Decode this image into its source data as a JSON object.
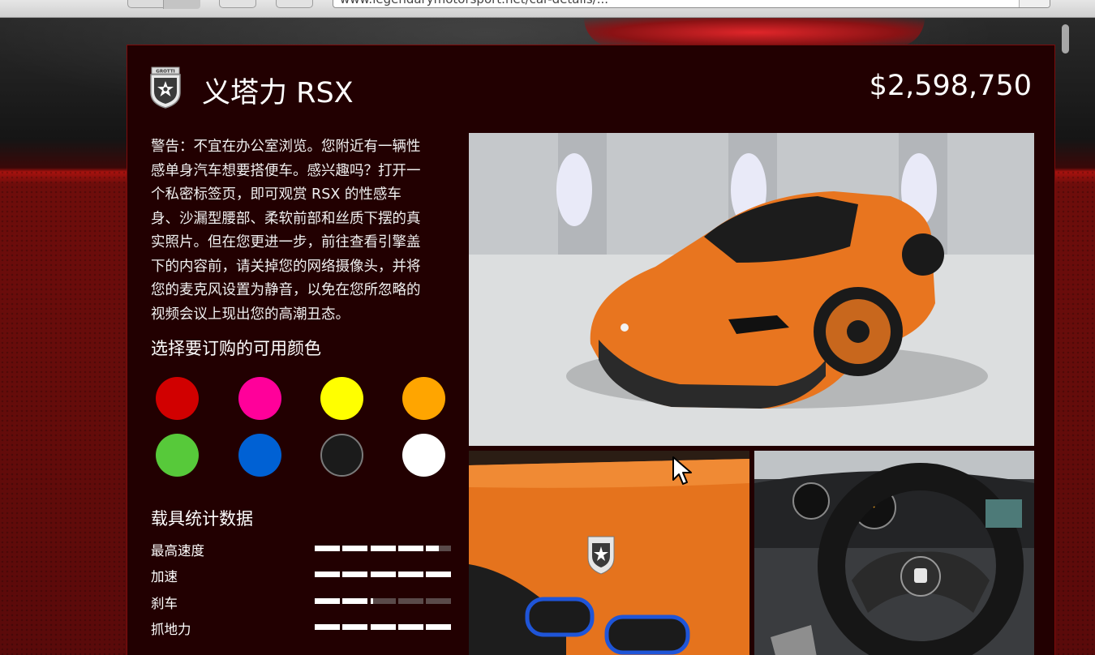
{
  "browser": {
    "url": "www.legendarymotorsport.net/car-details/..."
  },
  "car": {
    "brand_logo_text": "GROTTI",
    "title": "义塔力 RSX",
    "price": "$2,598,750",
    "description": "警告：不宜在办公室浏览。您附近有一辆性\n感单身汽车想要搭便车。感兴趣吗？打开一\n个私密标签页，即可观赏 RSX 的性感车\n身、沙漏型腰部、柔软前部和丝质下摆的真\n实照片。但在您更进一步，前往查看引擎盖\n下的内容前，请关掉您的网络摄像头，并将\n您的麦克风设置为静音，以免在您所忽略的\n视频会议上现出您的高潮丑态。"
  },
  "colors": {
    "title": "选择要订购的可用颜色",
    "swatches": [
      {
        "name": "red",
        "hex": "#d10000"
      },
      {
        "name": "magenta",
        "hex": "#ff009a"
      },
      {
        "name": "yellow",
        "hex": "#ffff00"
      },
      {
        "name": "orange",
        "hex": "#ffa500"
      },
      {
        "name": "green",
        "hex": "#57c93a"
      },
      {
        "name": "blue",
        "hex": "#0061d4"
      },
      {
        "name": "black",
        "hex": "#1b1b1b"
      },
      {
        "name": "white",
        "hex": "#ffffff"
      }
    ]
  },
  "stats": {
    "title": "载具统计数据",
    "items": [
      {
        "label": "最高速度",
        "value": 0.9
      },
      {
        "label": "加速",
        "value": 1.0
      },
      {
        "label": "刹车",
        "value": 0.42
      },
      {
        "label": "抓地力",
        "value": 1.0
      }
    ]
  },
  "theme": {
    "panel_bg": "#220001",
    "panel_border": "#7d0c0c",
    "accent_red": "#a8120e",
    "car_orange": "#e8751f"
  },
  "icons": [
    "grotti-shield-logo",
    "mouse-cursor"
  ]
}
